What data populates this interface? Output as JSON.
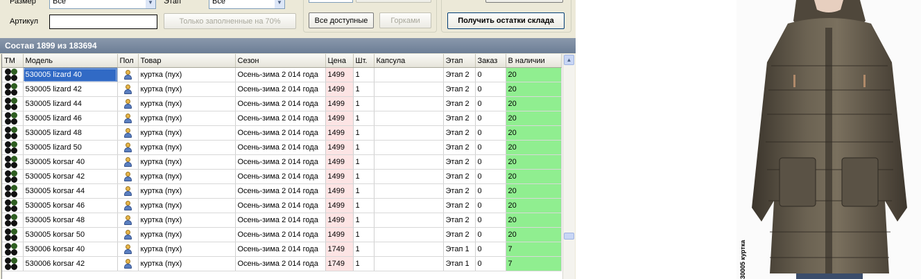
{
  "filters": {
    "size_label": "Размер",
    "size_value": "Все",
    "stage_label": "Этап",
    "stage_value": "Все",
    "article_label": "Артикул",
    "article_value": "",
    "filled70_label": "Только заполненные на 70%",
    "all_available_label": "Все доступные",
    "hills_label": "Горками",
    "get_stock_label": "Получить остатки склада"
  },
  "grid": {
    "title": "Состав 1899 из 183694",
    "columns": [
      "ТМ",
      "Модель",
      "Пол",
      "Товар",
      "Сезон",
      "Цена",
      "Шт.",
      "Капсула",
      "Этап",
      "Заказ",
      "В наличии"
    ],
    "rows": [
      {
        "model": "530005 lizard  40",
        "product": "куртка (пух)",
        "season": "Осень-зима 2 014 года",
        "price": "1499",
        "qty": "1",
        "capsule": "",
        "stage": "Этап 2",
        "order": "0",
        "stock": "20"
      },
      {
        "model": "530005 lizard  42",
        "product": "куртка (пух)",
        "season": "Осень-зима 2 014 года",
        "price": "1499",
        "qty": "1",
        "capsule": "",
        "stage": "Этап 2",
        "order": "0",
        "stock": "20"
      },
      {
        "model": "530005 lizard  44",
        "product": "куртка (пух)",
        "season": "Осень-зима 2 014 года",
        "price": "1499",
        "qty": "1",
        "capsule": "",
        "stage": "Этап 2",
        "order": "0",
        "stock": "20"
      },
      {
        "model": "530005 lizard  46",
        "product": "куртка (пух)",
        "season": "Осень-зима 2 014 года",
        "price": "1499",
        "qty": "1",
        "capsule": "",
        "stage": "Этап 2",
        "order": "0",
        "stock": "20"
      },
      {
        "model": "530005 lizard  48",
        "product": "куртка (пух)",
        "season": "Осень-зима 2 014 года",
        "price": "1499",
        "qty": "1",
        "capsule": "",
        "stage": "Этап 2",
        "order": "0",
        "stock": "20"
      },
      {
        "model": "530005 lizard  50",
        "product": "куртка (пух)",
        "season": "Осень-зима 2 014 года",
        "price": "1499",
        "qty": "1",
        "capsule": "",
        "stage": "Этап 2",
        "order": "0",
        "stock": "20"
      },
      {
        "model": "530005 korsar  40",
        "product": "куртка (пух)",
        "season": "Осень-зима 2 014 года",
        "price": "1499",
        "qty": "1",
        "capsule": "",
        "stage": "Этап 2",
        "order": "0",
        "stock": "20"
      },
      {
        "model": "530005 korsar  42",
        "product": "куртка (пух)",
        "season": "Осень-зима 2 014 года",
        "price": "1499",
        "qty": "1",
        "capsule": "",
        "stage": "Этап 2",
        "order": "0",
        "stock": "20"
      },
      {
        "model": "530005 korsar  44",
        "product": "куртка (пух)",
        "season": "Осень-зима 2 014 года",
        "price": "1499",
        "qty": "1",
        "capsule": "",
        "stage": "Этап 2",
        "order": "0",
        "stock": "20"
      },
      {
        "model": "530005 korsar  46",
        "product": "куртка (пух)",
        "season": "Осень-зима 2 014 года",
        "price": "1499",
        "qty": "1",
        "capsule": "",
        "stage": "Этап 2",
        "order": "0",
        "stock": "20"
      },
      {
        "model": "530005 korsar  48",
        "product": "куртка (пух)",
        "season": "Осень-зима 2 014 года",
        "price": "1499",
        "qty": "1",
        "capsule": "",
        "stage": "Этап 2",
        "order": "0",
        "stock": "20"
      },
      {
        "model": "530005 korsar  50",
        "product": "куртка (пух)",
        "season": "Осень-зима 2 014 года",
        "price": "1499",
        "qty": "1",
        "capsule": "",
        "stage": "Этап 2",
        "order": "0",
        "stock": "20"
      },
      {
        "model": "530006 korsar  40",
        "product": "куртка (пух)",
        "season": "Осень-зима 2 014 года",
        "price": "1749",
        "qty": "1",
        "capsule": "",
        "stage": "Этап 1",
        "order": "0",
        "stock": "7"
      },
      {
        "model": "530006 korsar  42",
        "product": "куртка (пух)",
        "season": "Осень-зима 2 014 года",
        "price": "1749",
        "qty": "1",
        "capsule": "",
        "stage": "Этап 1",
        "order": "0",
        "stock": "7"
      }
    ]
  },
  "product_image": {
    "caption": "30005 куртка"
  },
  "icons": {
    "tm": "brand-dots-icon",
    "gender": "female-person-icon",
    "scroll_up": "chevron-up-icon"
  },
  "colors": {
    "price_cell": "#fde4e4",
    "stock_cell": "#90ee90",
    "title_bar": "#7b8ba1",
    "selection": "#316ac5"
  }
}
